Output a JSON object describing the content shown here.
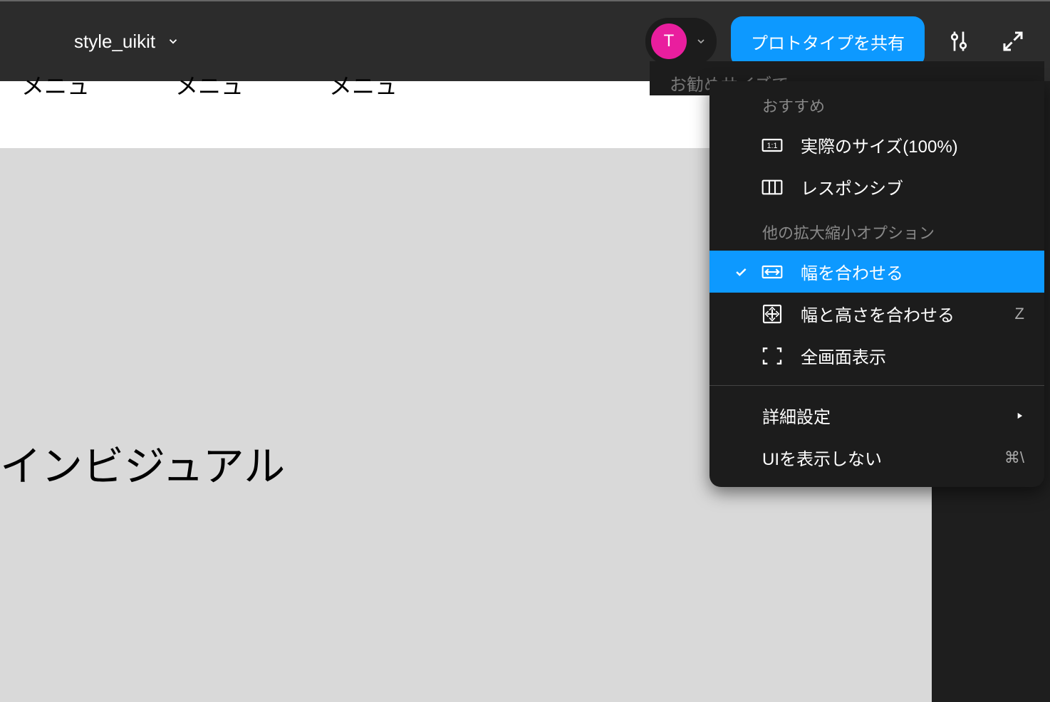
{
  "toolbar": {
    "file_name": "style_uikit",
    "avatar_initial": "T",
    "share_label": "プロトタイプを共有"
  },
  "canvas": {
    "menu_items": [
      "メニュ",
      "メニュ",
      "メニュ"
    ],
    "main_visual_text": "インビジュアル"
  },
  "dropdown": {
    "partial_header_text": "お勧めサイズで",
    "section1_header": "おすすめ",
    "actual_size_label": "実際のサイズ(100%)",
    "responsive_label": "レスポンシブ",
    "section2_header": "他の拡大縮小オプション",
    "fit_width_label": "幅を合わせる",
    "fit_width_height_label": "幅と高さを合わせる",
    "fit_width_height_shortcut": "Z",
    "fullscreen_label": "全画面表示",
    "advanced_label": "詳細設定",
    "hide_ui_label": "UIを表示しない",
    "hide_ui_shortcut": "⌘\\"
  }
}
